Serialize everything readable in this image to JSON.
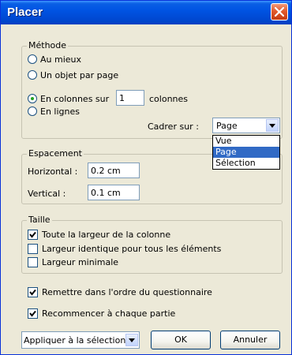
{
  "window": {
    "title": "Placer"
  },
  "methode": {
    "legend": "Méthode",
    "options": {
      "au_mieux": "Au mieux",
      "un_objet": "Un objet par page",
      "en_colonnes_prefix": "En colonnes sur",
      "en_colonnes_value": "1",
      "en_colonnes_suffix": "colonnes",
      "en_lignes": "En lignes"
    },
    "selected": "en_colonnes",
    "cadrer_label": "Cadrer sur :",
    "cadrer_value": "Page",
    "cadrer_options": [
      "Vue",
      "Page",
      "Sélection"
    ],
    "cadrer_highlighted": "Page"
  },
  "espacement": {
    "legend": "Espacement",
    "horizontal_label": "Horizontal :",
    "horizontal_value": "0.2 cm",
    "vertical_label": "Vertical :",
    "vertical_value": "0.1 cm"
  },
  "taille": {
    "legend": "Taille",
    "options": [
      {
        "label": "Toute la largeur de la colonne",
        "checked": true
      },
      {
        "label": "Largeur identique pour tous les éléments",
        "checked": false
      },
      {
        "label": "Largeur minimale",
        "checked": false
      }
    ]
  },
  "remettre": {
    "label": "Remettre dans l'ordre du questionnaire",
    "checked": true
  },
  "recommencer": {
    "label": "Recommencer à chaque partie",
    "checked": true
  },
  "footer": {
    "apply_value": "Appliquer à la sélection",
    "ok_label": "OK",
    "cancel_label": "Annuler"
  }
}
